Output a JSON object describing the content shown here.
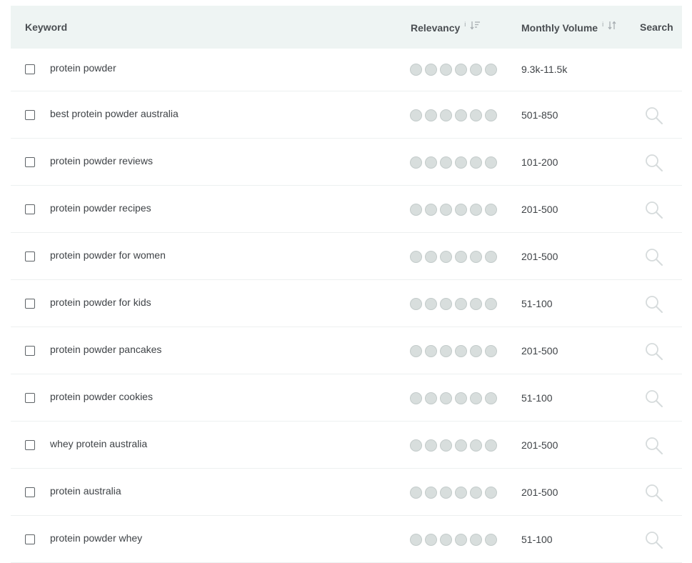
{
  "columns": {
    "keyword": "Keyword",
    "relevancy": "Relevancy",
    "relevancy_info": "i",
    "monthly_volume": "Monthly Volume",
    "monthly_volume_info": "i",
    "search": "Search"
  },
  "colors": {
    "header_bg": "#eef4f3",
    "dot_fill": "#d8dedd",
    "row_border": "#edf0f0",
    "search_icon": "#d6dbdc"
  },
  "rows": [
    {
      "keyword": "protein powder",
      "volume": "9.3k-11.5k",
      "relevancy_dots": 6,
      "has_search": false
    },
    {
      "keyword": "best protein powder australia",
      "volume": "501-850",
      "relevancy_dots": 6,
      "has_search": true
    },
    {
      "keyword": "protein powder reviews",
      "volume": "101-200",
      "relevancy_dots": 6,
      "has_search": true
    },
    {
      "keyword": "protein powder recipes",
      "volume": "201-500",
      "relevancy_dots": 6,
      "has_search": true
    },
    {
      "keyword": "protein powder for women",
      "volume": "201-500",
      "relevancy_dots": 6,
      "has_search": true
    },
    {
      "keyword": "protein powder for kids",
      "volume": "51-100",
      "relevancy_dots": 6,
      "has_search": true
    },
    {
      "keyword": "protein powder pancakes",
      "volume": "201-500",
      "relevancy_dots": 6,
      "has_search": true
    },
    {
      "keyword": "protein powder cookies",
      "volume": "51-100",
      "relevancy_dots": 6,
      "has_search": true
    },
    {
      "keyword": "whey protein australia",
      "volume": "201-500",
      "relevancy_dots": 6,
      "has_search": true
    },
    {
      "keyword": "protein australia",
      "volume": "201-500",
      "relevancy_dots": 6,
      "has_search": true
    },
    {
      "keyword": "protein powder whey",
      "volume": "51-100",
      "relevancy_dots": 6,
      "has_search": true
    }
  ]
}
